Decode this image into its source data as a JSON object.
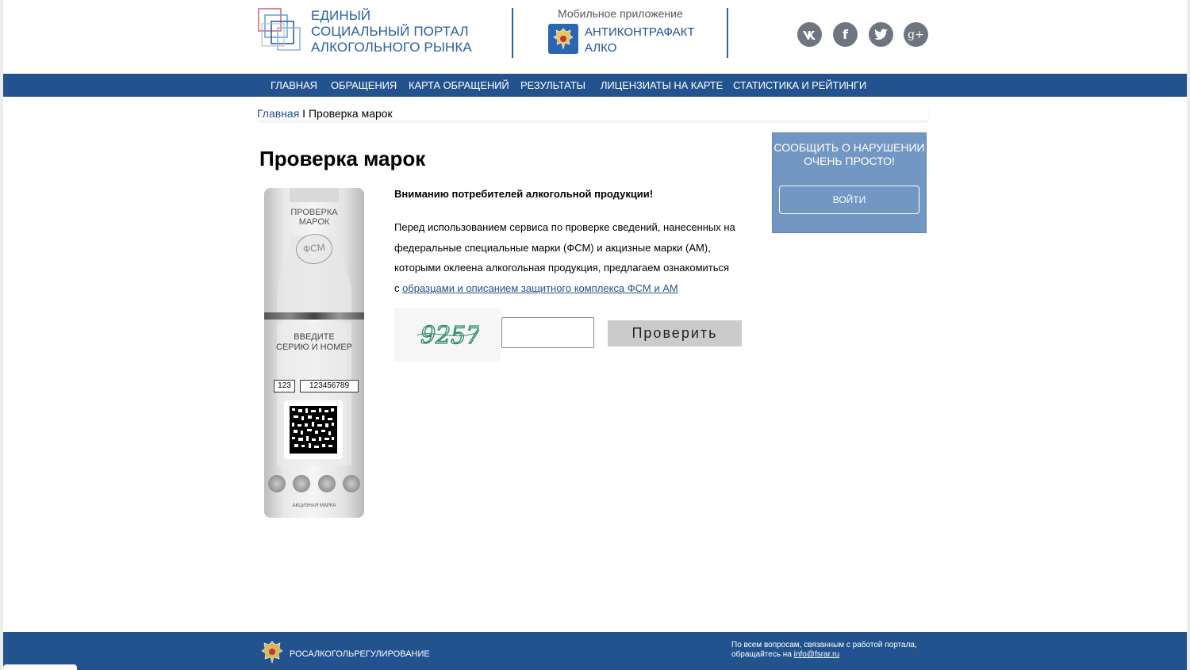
{
  "header": {
    "logo_lines": [
      "ЕДИНЫЙ",
      "СОЦИАЛЬНЫЙ ПОРТАЛ",
      "АЛКОГОЛЬНОГО РЫНКА"
    ],
    "app_caption": "Мобильное приложение",
    "app_name_lines": [
      "АНТИКОНТРАФАКТ",
      "АЛКО"
    ],
    "social": [
      {
        "name": "vk",
        "glyph": "vk"
      },
      {
        "name": "facebook",
        "glyph": "f"
      },
      {
        "name": "twitter",
        "glyph": "t"
      },
      {
        "name": "google-plus",
        "glyph": "g+"
      }
    ]
  },
  "nav": {
    "items": [
      "ГЛАВНАЯ",
      "ОБРАЩЕНИЯ",
      "КАРТА ОБРАЩЕНИЙ",
      "РЕЗУЛЬТАТЫ",
      "ЛИЦЕНЗИАТЫ НА КАРТЕ",
      "СТАТИСТИКА И РЕЙТИНГИ"
    ]
  },
  "breadcrumb": {
    "home": "Главная",
    "sep": " I ",
    "current": "Проверка марок"
  },
  "main": {
    "title": "Проверка марок",
    "warning": "Вниманию потребителей алкогольной продукции!",
    "para_lines": [
      "Перед использованием сервиса по проверке сведений, нанесенных на",
      "федеральные специальные марки (ФСМ) и акцизные марки (АМ),",
      "которыми оклеена алкогольная продукция, предлагаем ознакомиться"
    ],
    "para_prefix": "с ",
    "para_link": "образцами и описанием защитного комплекса ФСМ и АМ",
    "captcha_text": "9257",
    "captcha_value": "",
    "check_label": "Проверить"
  },
  "stamp": {
    "title_lines": [
      "ПРОВЕРКА",
      "МАРОК"
    ],
    "fsm": "ФСМ",
    "prompt_lines": [
      "ВВЕДИТЕ",
      "СЕРИЮ И НОМЕР"
    ],
    "series": "123",
    "number": "123456789",
    "bottom": "АКЦИЗНАЯ МАРКА"
  },
  "side": {
    "text": "СООБЩИТЬ О НАРУШЕНИИ ОЧЕНЬ ПРОСТО!",
    "login_label": "ВОЙТИ"
  },
  "footer": {
    "org": "РОСАЛКОГОЛЬРЕГУЛИРОВАНИЕ",
    "contact_line1": "По всем вопросам, связанным с работой портала,",
    "contact_prefix": "обращайтесь на ",
    "contact_email": "info@fsrar.ru"
  },
  "colors": {
    "brand_blue": "#22538f",
    "side_box": "#7297c2",
    "button_gray": "#cbcbcb"
  }
}
